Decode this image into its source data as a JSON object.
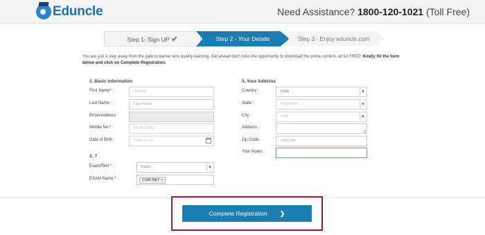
{
  "header": {
    "logo_text": "Eduncle",
    "assist_prefix": "Need Assistance?",
    "phone": "1800-120-1021",
    "assist_suffix": "(Toll Free)"
  },
  "steps": {
    "step1": "Step 1- Sign UP",
    "step2": "Step 2 - Your Details",
    "step3": "Step 3 - Enjoy eduncle.com"
  },
  "intro": {
    "text": "You are just 1 step away from the gate to barrier less quality learning. Get ahead don't miss the opportunity to download the prime content, all for FREE!",
    "bold": "Kindly fill the form below and click on Complete Registration."
  },
  "basic": {
    "title": "1. Basic Information",
    "first_name": {
      "label": "First Name",
      "req": "*",
      "sep": " :",
      "value": "Anurag"
    },
    "last_name": {
      "label": "Last Name :",
      "placeholder": "Last Name"
    },
    "email": {
      "label": "Email Address :",
      "value": ""
    },
    "mobile": {
      "label": "Mobile No.",
      "req": "*",
      "sep": " :",
      "value": "9178012852"
    },
    "dob": {
      "label": "Date of Birth :",
      "value": "1984-10-21"
    }
  },
  "section2": {
    "title": "2. ?",
    "exam_skill": {
      "label": "Exam/Skill",
      "req": "*",
      "sep": " :",
      "value": "Exam"
    },
    "exam_name": {
      "label": "EXAM   Name",
      "req": "*",
      "sep": " :",
      "tag": "CSIR NET",
      "tag_close": "×"
    }
  },
  "address": {
    "title": "3. Your Address",
    "country": {
      "label": "Country :",
      "value": "India"
    },
    "state": {
      "label": "State :",
      "value": "Rajasthan"
    },
    "city": {
      "label": "City :",
      "value": "Kota"
    },
    "address": {
      "label": "Address :",
      "value": ""
    },
    "zip": {
      "label": "Zip Code :",
      "placeholder": "Zip Code"
    },
    "notes": {
      "label": "Your Notes :",
      "value": ""
    }
  },
  "cta": {
    "label": "Complete Registration",
    "arrow": "❯"
  },
  "colors": {
    "primary": "#1b7eb3",
    "highlight_border": "#a61b2b",
    "required": "#dd0000",
    "check": "#3aa33a"
  }
}
